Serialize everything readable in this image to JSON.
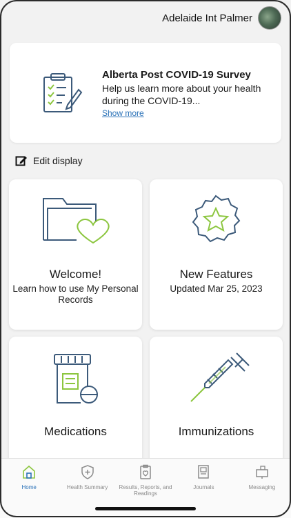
{
  "header": {
    "user_name": "Adelaide Int Palmer"
  },
  "survey": {
    "title": "Alberta Post COVID-19 Survey",
    "description": "Help us learn more about your health during the COVID-19...",
    "link": "Show more"
  },
  "edit_display": {
    "label": "Edit display"
  },
  "tiles": [
    {
      "title": "Welcome!",
      "subtitle": "Learn how to use My Personal Records",
      "icon": "folder-heart-icon"
    },
    {
      "title": "New Features",
      "subtitle": "Updated Mar 25, 2023",
      "icon": "star-badge-icon"
    },
    {
      "title": "Medications",
      "subtitle": "",
      "icon": "pill-bottle-icon"
    },
    {
      "title": "Immunizations",
      "subtitle": "",
      "icon": "syringe-icon"
    }
  ],
  "tab_bar": {
    "tabs": [
      {
        "label": "Home",
        "icon": "home-icon",
        "active": true
      },
      {
        "label": "Health Summary",
        "icon": "shield-plus-icon"
      },
      {
        "label": "Results, Reports, and Readings",
        "icon": "clipboard-heart-icon"
      },
      {
        "label": "Journals",
        "icon": "journal-icon"
      },
      {
        "label": "Messaging",
        "icon": "mailbox-icon"
      }
    ]
  },
  "colors": {
    "accent": "#2b72b8",
    "icon_blue": "#3c5a7a",
    "icon_green": "#8cc63f"
  }
}
